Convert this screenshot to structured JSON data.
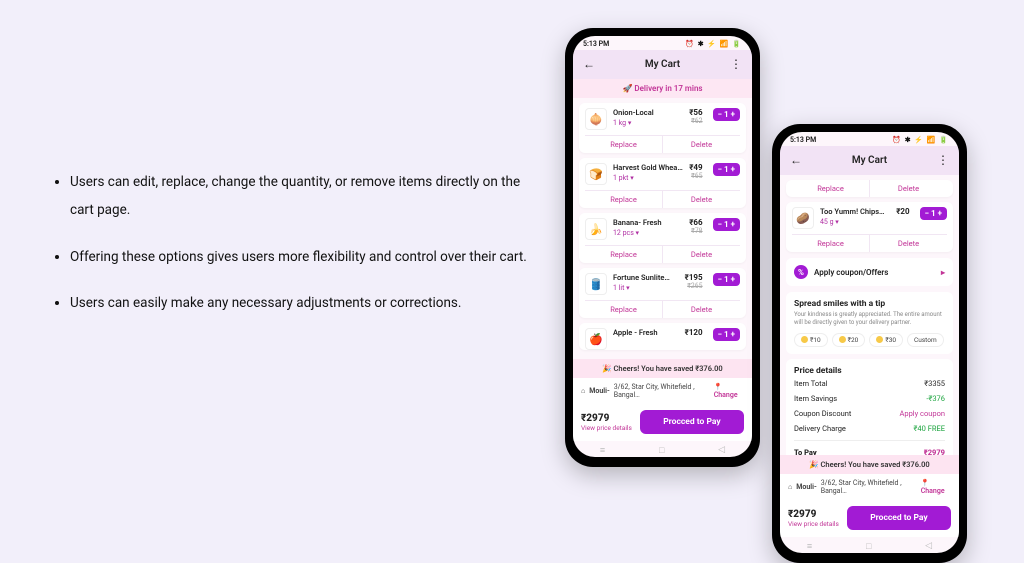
{
  "bullets": [
    "Users can edit, replace, change the quantity, or remove items directly on the cart page.",
    "Offering these options gives users more flexibility and control over their cart.",
    "Users can easily make any necessary adjustments or corrections."
  ],
  "common": {
    "time": "5:13 PM",
    "status_icons": "⏰ ✱ ⚡ 📶 🔋",
    "title": "My Cart",
    "delivery": "Delivery in 17 mins",
    "replace": "Replace",
    "delete": "Delete",
    "cheers": "🎉 Cheers! You have saved ₹376.00",
    "address_label": "Mouli-",
    "address": "3/62, Star City, Whitefield , Bangal…",
    "change": "📍 Change",
    "pay_total": "₹2979",
    "pay_link": "View price details",
    "pay_btn": "Procced to Pay",
    "home_icon": "⌂"
  },
  "a_items": [
    {
      "name": "Onion-Local",
      "qty": "1 kg",
      "price": "₹56",
      "old": "₹62",
      "count": "1",
      "emoji": "🧅"
    },
    {
      "name": "Harvest Gold Wheat…",
      "qty": "1 pkt",
      "price": "₹49",
      "old": "₹65",
      "count": "1",
      "emoji": "🍞"
    },
    {
      "name": "Banana- Fresh",
      "qty": "12 pcs",
      "price": "₹66",
      "old": "₹78",
      "count": "1",
      "emoji": "🍌"
    },
    {
      "name": "Fortune Sunlite…",
      "qty": "1 lit",
      "price": "₹195",
      "old": "₹265",
      "count": "1",
      "emoji": "🛢️"
    },
    {
      "name": "Apple - Fresh",
      "qty": "",
      "price": "₹120",
      "old": "",
      "count": "1",
      "emoji": "🍎"
    }
  ],
  "b_item": {
    "name": "Too Yumm! Chips…",
    "qty": "45 g",
    "price": "₹20",
    "old": "",
    "count": "1",
    "emoji": "🥔"
  },
  "coupon": {
    "label": "Apply coupon/Offers",
    "arrow": "▸"
  },
  "tip": {
    "title": "Spread smiles with a tip",
    "sub": "Your kindness is greatly appreciated. The entire amount will be directly given to your delivery partner.",
    "opts": [
      "₹10",
      "₹20",
      "₹30",
      "Custom"
    ]
  },
  "price": {
    "title": "Price details",
    "rows": [
      {
        "l": "Item Total",
        "r": "₹3355",
        "cls": ""
      },
      {
        "l": "Item Savings",
        "r": "-₹376",
        "cls": "green"
      },
      {
        "l": "Coupon Discount",
        "r": "Apply coupon",
        "cls": "mag"
      },
      {
        "l": "Delivery Charge",
        "r": "₹40 FREE",
        "cls": "green"
      }
    ],
    "to_pay_l": "To Pay",
    "to_pay_r": "₹2979"
  }
}
